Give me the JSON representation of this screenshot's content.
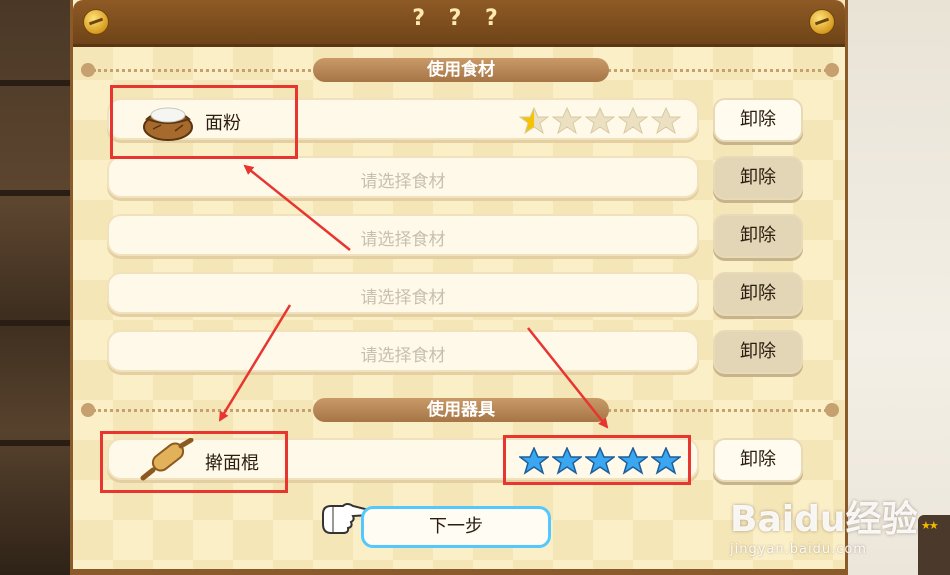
{
  "window": {
    "title": "? ? ?"
  },
  "sections": {
    "ingredients_label": "使用食材",
    "tools_label": "使用器具"
  },
  "ingredients": [
    {
      "name": "面粉",
      "placeholder": "",
      "icon": "flour-sack-icon",
      "rating": 0.5,
      "remove_label": "卸除"
    },
    {
      "name": "",
      "placeholder": "请选择食材",
      "remove_label": "卸除"
    },
    {
      "name": "",
      "placeholder": "请选择食材",
      "remove_label": "卸除"
    },
    {
      "name": "",
      "placeholder": "请选择食材",
      "remove_label": "卸除"
    },
    {
      "name": "",
      "placeholder": "请选择食材",
      "remove_label": "卸除"
    }
  ],
  "tool": {
    "name": "擀面棍",
    "icon": "rolling-pin-icon",
    "rating": 5,
    "remove_label": "卸除"
  },
  "next_button": {
    "label": "下一步"
  },
  "watermark": {
    "brand": "Baidu经验",
    "site": "jingyan.baidu.com"
  },
  "colors": {
    "header": "#7a4a1c",
    "highlight": "#e8352f",
    "star_blue": "#3aa7f0",
    "star_gold": "#f5c400",
    "next_border": "#52c8ff"
  }
}
